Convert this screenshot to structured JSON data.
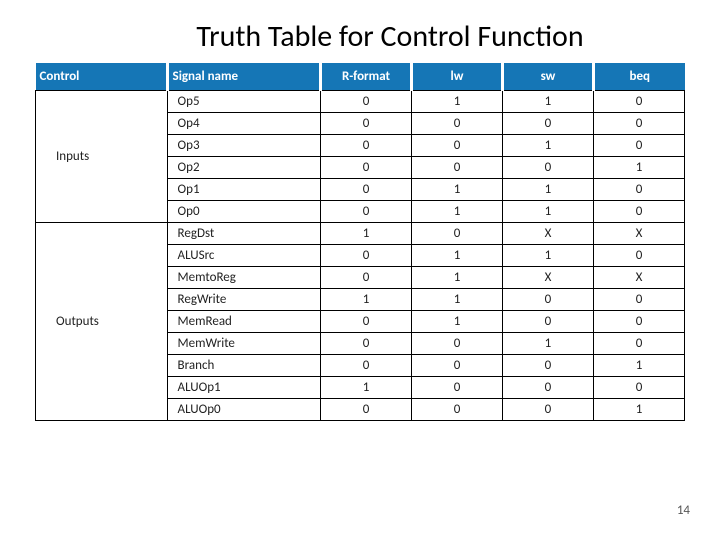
{
  "title": "Truth Table for Control Function",
  "page_number": "14",
  "headers": {
    "control": "Control",
    "signal": "Signal name",
    "rformat": "R-format",
    "lw": "lw",
    "sw": "sw",
    "beq": "beq"
  },
  "chart_data": {
    "type": "table",
    "columns": [
      "Control",
      "Signal name",
      "R-format",
      "lw",
      "sw",
      "beq"
    ],
    "groups": [
      {
        "category": "Inputs",
        "rows": [
          {
            "name": "Op5",
            "r": "0",
            "lw": "1",
            "sw": "1",
            "beq": "0"
          },
          {
            "name": "Op4",
            "r": "0",
            "lw": "0",
            "sw": "0",
            "beq": "0"
          },
          {
            "name": "Op3",
            "r": "0",
            "lw": "0",
            "sw": "1",
            "beq": "0"
          },
          {
            "name": "Op2",
            "r": "0",
            "lw": "0",
            "sw": "0",
            "beq": "1"
          },
          {
            "name": "Op1",
            "r": "0",
            "lw": "1",
            "sw": "1",
            "beq": "0"
          },
          {
            "name": "Op0",
            "r": "0",
            "lw": "1",
            "sw": "1",
            "beq": "0"
          }
        ]
      },
      {
        "category": "Outputs",
        "rows": [
          {
            "name": "RegDst",
            "r": "1",
            "lw": "0",
            "sw": "X",
            "beq": "X"
          },
          {
            "name": "ALUSrc",
            "r": "0",
            "lw": "1",
            "sw": "1",
            "beq": "0"
          },
          {
            "name": "MemtoReg",
            "r": "0",
            "lw": "1",
            "sw": "X",
            "beq": "X"
          },
          {
            "name": "RegWrite",
            "r": "1",
            "lw": "1",
            "sw": "0",
            "beq": "0"
          },
          {
            "name": "MemRead",
            "r": "0",
            "lw": "1",
            "sw": "0",
            "beq": "0"
          },
          {
            "name": "MemWrite",
            "r": "0",
            "lw": "0",
            "sw": "1",
            "beq": "0"
          },
          {
            "name": "Branch",
            "r": "0",
            "lw": "0",
            "sw": "0",
            "beq": "1"
          },
          {
            "name": "ALUOp1",
            "r": "1",
            "lw": "0",
            "sw": "0",
            "beq": "0"
          },
          {
            "name": "ALUOp0",
            "r": "0",
            "lw": "0",
            "sw": "0",
            "beq": "1"
          }
        ]
      }
    ]
  }
}
